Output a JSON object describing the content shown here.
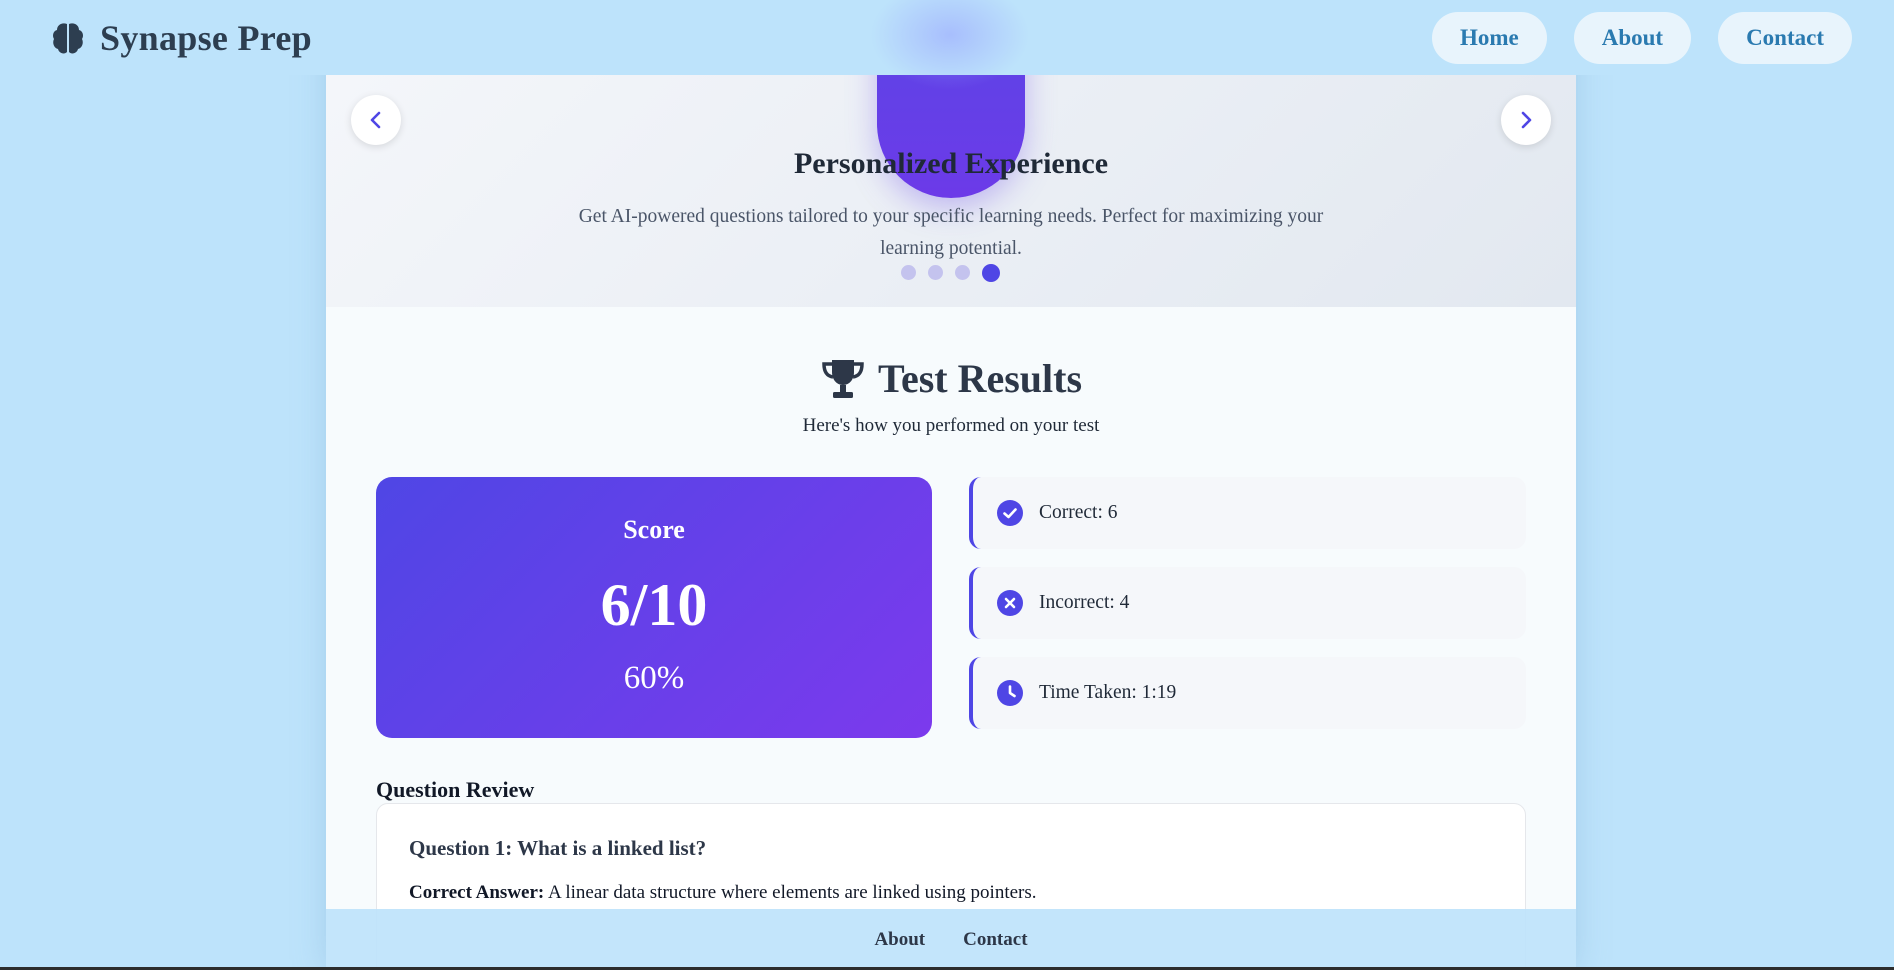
{
  "header": {
    "brand_icon": "brain-icon",
    "brand_name": "Synapse Prep",
    "nav": [
      {
        "label": "Home"
      },
      {
        "label": "About"
      },
      {
        "label": "Contact"
      }
    ]
  },
  "carousel": {
    "slide_icon": "slide-badge-icon",
    "title": "Personalized Experience",
    "description": "Get AI-powered questions tailored to your specific learning needs. Perfect for maximizing your learning potential.",
    "prev_icon": "chevron-left-icon",
    "next_icon": "chevron-right-icon",
    "slide_count": 4,
    "active_slide": 4
  },
  "results": {
    "icon": "trophy-icon",
    "title": "Test Results",
    "subtitle": "Here's how you performed on your test",
    "score": {
      "label": "Score",
      "value": "6/10",
      "percent": "60%"
    },
    "stats": [
      {
        "icon": "check-circle-icon",
        "text": "Correct: 6"
      },
      {
        "icon": "x-circle-icon",
        "text": "Incorrect: 4"
      },
      {
        "icon": "clock-icon",
        "text": "Time Taken: 1:19"
      }
    ]
  },
  "review": {
    "title": "Question Review",
    "questions": [
      {
        "title": "Question 1: What is a linked list?",
        "answer_label": "Correct Answer:",
        "answer": "A linear data structure where elements are linked using pointers."
      }
    ]
  },
  "footer": {
    "links": [
      {
        "label": "About"
      },
      {
        "label": "Contact"
      }
    ]
  },
  "colors": {
    "background": "#bde3fb",
    "accent": "#4f46e5",
    "accent_secondary": "#7c3aed",
    "nav_text": "#2a7ab0"
  }
}
